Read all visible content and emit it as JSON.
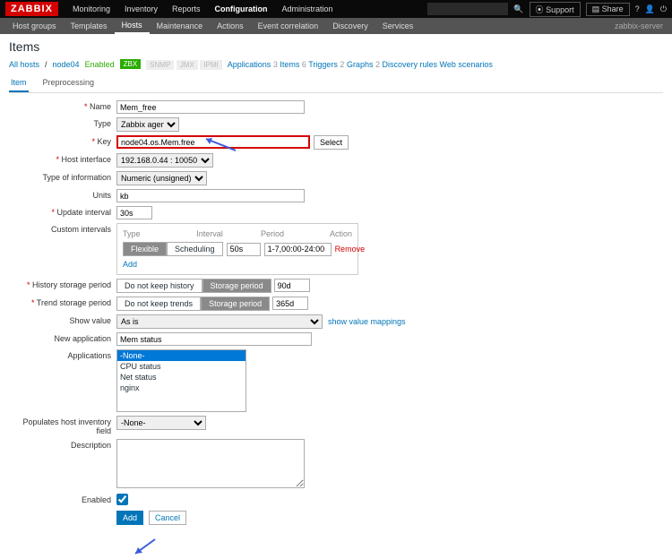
{
  "brand": "ZABBIX",
  "topnav": [
    "Monitoring",
    "Inventory",
    "Reports",
    "Configuration",
    "Administration"
  ],
  "topnav_active": 3,
  "topr": {
    "support": "Support",
    "share": "Share"
  },
  "subnav": [
    "Host groups",
    "Templates",
    "Hosts",
    "Maintenance",
    "Actions",
    "Event correlation",
    "Discovery",
    "Services"
  ],
  "subnav_active": 2,
  "server": "zabbix-server",
  "title": "Items",
  "bc": {
    "all": "All hosts",
    "host": "node04",
    "enabled": "Enabled",
    "zbx": "ZBX",
    "tags": [
      "SNMP",
      "JMX",
      "IPMI"
    ],
    "links": [
      {
        "t": "Applications",
        "n": "3"
      },
      {
        "t": "Items",
        "n": "6"
      },
      {
        "t": "Triggers",
        "n": "2"
      },
      {
        "t": "Graphs",
        "n": "2"
      },
      {
        "t": "Discovery rules",
        "n": ""
      },
      {
        "t": "Web scenarios",
        "n": ""
      }
    ]
  },
  "tabs": [
    "Item",
    "Preprocessing"
  ],
  "f": {
    "name_l": "Name",
    "name_v": "Mem_free",
    "type_l": "Type",
    "type_v": "Zabbix agent",
    "key_l": "Key",
    "key_v": "node04.os.Mem.free",
    "select": "Select",
    "hi_l": "Host interface",
    "hi_v": "192.168.0.44 : 10050",
    "toi_l": "Type of information",
    "toi_v": "Numeric (unsigned)",
    "units_l": "Units",
    "units_v": "kb",
    "ui_l": "Update interval",
    "ui_v": "30s",
    "ci_l": "Custom intervals",
    "ci_h": [
      "Type",
      "Interval",
      "Period",
      "Action"
    ],
    "ci_flex": "Flexible",
    "ci_sched": "Scheduling",
    "ci_int": "50s",
    "ci_per": "1-7,00:00-24:00",
    "ci_rem": "Remove",
    "ci_add": "Add",
    "hsp_l": "History storage period",
    "dnk_h": "Do not keep history",
    "sp": "Storage period",
    "hsp_v": "90d",
    "tsp_l": "Trend storage period",
    "dnk_t": "Do not keep trends",
    "tsp_v": "365d",
    "sv_l": "Show value",
    "sv_v": "As is",
    "sv_link": "show value mappings",
    "na_l": "New application",
    "na_v": "Mem status",
    "apps_l": "Applications",
    "apps": [
      "-None-",
      "CPU status",
      "Net status",
      "nginx"
    ],
    "phi_l": "Populates host inventory field",
    "phi_v": "-None-",
    "desc_l": "Description",
    "en_l": "Enabled",
    "add": "Add",
    "cancel": "Cancel"
  }
}
